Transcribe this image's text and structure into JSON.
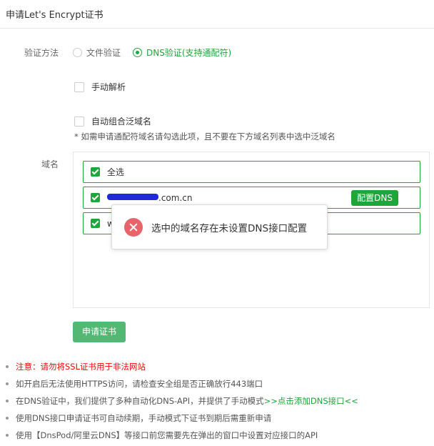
{
  "header": {
    "title": "申请Let's Encrypt证书"
  },
  "verify": {
    "label": "验证方法",
    "options": [
      {
        "label": "文件验证",
        "checked": false
      },
      {
        "label": "DNS验证(支持通配符)",
        "checked": true
      }
    ]
  },
  "manual": {
    "label": "手动解析",
    "checked": false
  },
  "wildcard": {
    "label": "自动组合泛域名",
    "checked": false
  },
  "hint": "* 如需申请通配符域名请勾选此项，且不要在下方域名列表中选中泛域名",
  "domains": {
    "label": "域名",
    "select_all": "全选",
    "items": [
      {
        "suffix": ".com.cn",
        "checked": true,
        "button": "配置DNS"
      },
      {
        "prefix": "w",
        "checked": true
      }
    ]
  },
  "toast": {
    "message": "选中的域名存在未设置DNS接口配置"
  },
  "apply_button": "申请证书",
  "notes": [
    "注意：请勿将SSL证书用于非法网站",
    "如开启后无法使用HTTPS访问，请检查安全组是否正确放行443端口",
    "在DNS验证中，我们提供了多种自动化DNS-API，并提供了手动模式",
    ">>点击添加DNS接口<<",
    "使用DNS接口申请证书可自动续期，手动模式下证书到期后需重新申请",
    "使用【DnsPod/阿里云DNS】等接口前您需要先在弹出的窗口中设置对应接口的API"
  ],
  "colors": {
    "accent": "#20a53a",
    "warning": "#ef0808",
    "error_icon": "#e9636a"
  }
}
